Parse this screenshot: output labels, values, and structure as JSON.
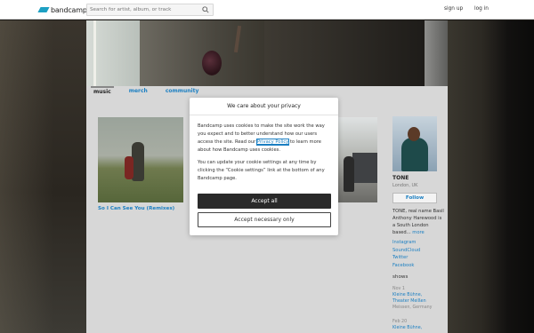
{
  "header": {
    "logo_text": "bandcamp",
    "search": {
      "placeholder": "Search for artist, album, or track",
      "icon": "search-icon"
    },
    "signup_label": "sign up",
    "login_label": "log in"
  },
  "artist_page": {
    "tabs": [
      {
        "label": "music",
        "active": true
      },
      {
        "label": "merch",
        "active": false
      },
      {
        "label": "community",
        "active": false
      }
    ],
    "albums": [
      {
        "title": "So I Can See You (Remixes)"
      }
    ],
    "artist": {
      "name": "TONE",
      "location": "London, UK",
      "follow_label": "Follow",
      "bio": "TONE, real name Basil Anthony Harewood is a South London based...",
      "bio_more": "more",
      "links": [
        "Instagram",
        "SoundCloud",
        "Twitter",
        "Facebook"
      ]
    },
    "shows_heading": "shows",
    "shows": [
      {
        "date": "Nov 1",
        "venue_line1": "Kleine Bühne,",
        "venue_line2": "Theater Meißen",
        "place": "Meissen, Germany"
      },
      {
        "date": "Feb 20",
        "venue_line1": "Kleine Bühne,",
        "venue_line2": "",
        "place": ""
      }
    ]
  },
  "privacy_modal": {
    "title": "We care about your privacy",
    "paragraph1_before": "Bandcamp uses cookies to make the site work the way you expect and to better understand how our users access the site. Read our ",
    "policy_link": "Privacy Policy",
    "paragraph1_after": " to learn more about how Bandcamp uses cookies.",
    "paragraph2": "You can update your cookie settings at any time by clicking the “Cookie settings” link at the bottom of any Bandcamp page.",
    "accept_all_label": "Accept all",
    "accept_necessary_label": "Accept necessary only"
  },
  "colors": {
    "brand_blue": "#1da0c3",
    "link_blue": "#1b7fc2",
    "accept_button": "#2a2a2a"
  }
}
